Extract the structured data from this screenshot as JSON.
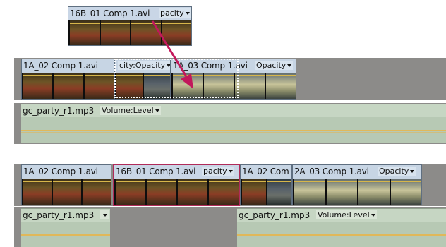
{
  "dragged_clip": {
    "name": "16B_01 Comp 1.avi",
    "property": "pacity"
  },
  "before": {
    "video": [
      {
        "name": "1A_02 Comp 1.avi",
        "property": "city:Opacity"
      },
      {
        "name": "1A_03 Comp 1.avi",
        "property": "Opacity"
      }
    ],
    "audio": {
      "name": "gc_party_r1.mp3",
      "property": "Volume:Level"
    }
  },
  "after": {
    "video": [
      {
        "name": "1A_02 Comp 1.avi",
        "property": ""
      },
      {
        "name": "16B_01 Comp 1.avi",
        "property": "pacity"
      },
      {
        "name": "1A_02 Com",
        "property": ""
      },
      {
        "name": "2A_03 Comp 1.avi",
        "property": "Opacity"
      }
    ],
    "audio": [
      {
        "name": "gc_party_r1.mp3",
        "property": ""
      },
      {
        "name": "gc_party_r1.mp3",
        "property": "Volume:Level"
      }
    ]
  },
  "colors": {
    "selection": "#b02b5a",
    "arrow": "#c2185b",
    "video_clip": "#c7d5e4",
    "audio_clip": "#c6d6c3"
  }
}
